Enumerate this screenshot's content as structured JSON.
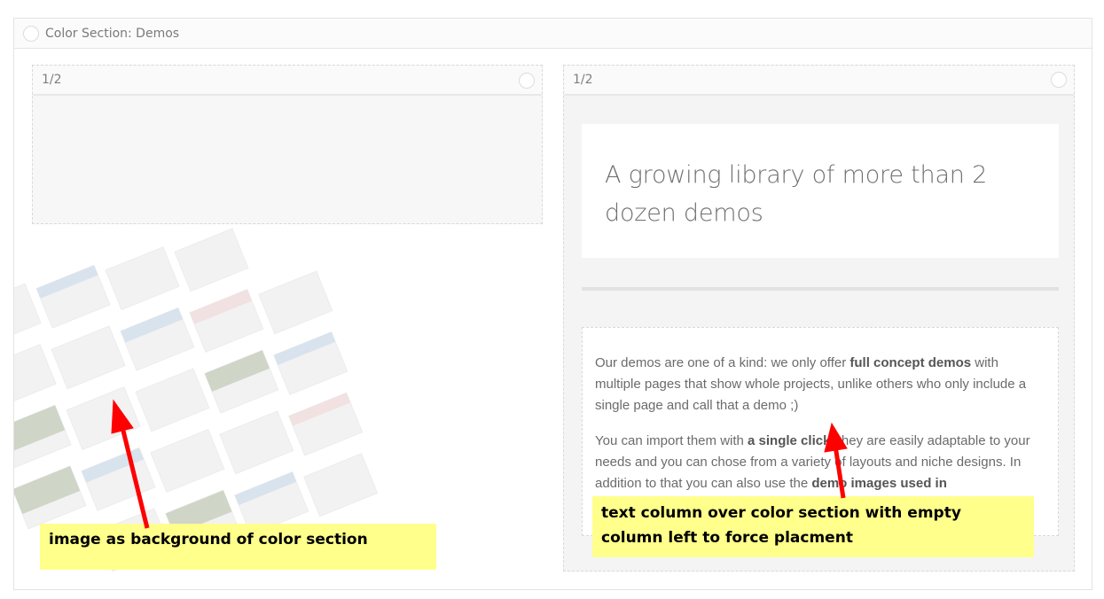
{
  "section": {
    "title": "Color Section: Demos"
  },
  "columns": [
    {
      "label": "1/2"
    },
    {
      "label": "1/2"
    }
  ],
  "heading": "A growing library of more than 2 dozen demos",
  "paragraphs": {
    "p1": {
      "a": "Our demos are one of a kind: we only offer ",
      "b": "full concept demos",
      "c": " with multiple pages that show whole projects, unlike others who only include a single page and call that a demo ;)"
    },
    "p2": {
      "a": "You can import them with ",
      "b": "a single click",
      "c": ", they are easily adaptable to your needs and you can chose from a variety of layouts and niche designs. In addition to that you can also use the ",
      "d": "demo images used in"
    }
  },
  "annotations": {
    "left": "image as background of color section",
    "right": "text column over color section with empty column left to force placment"
  },
  "colors": {
    "callout": "#ffff8c",
    "arrow": "#ff0000"
  }
}
